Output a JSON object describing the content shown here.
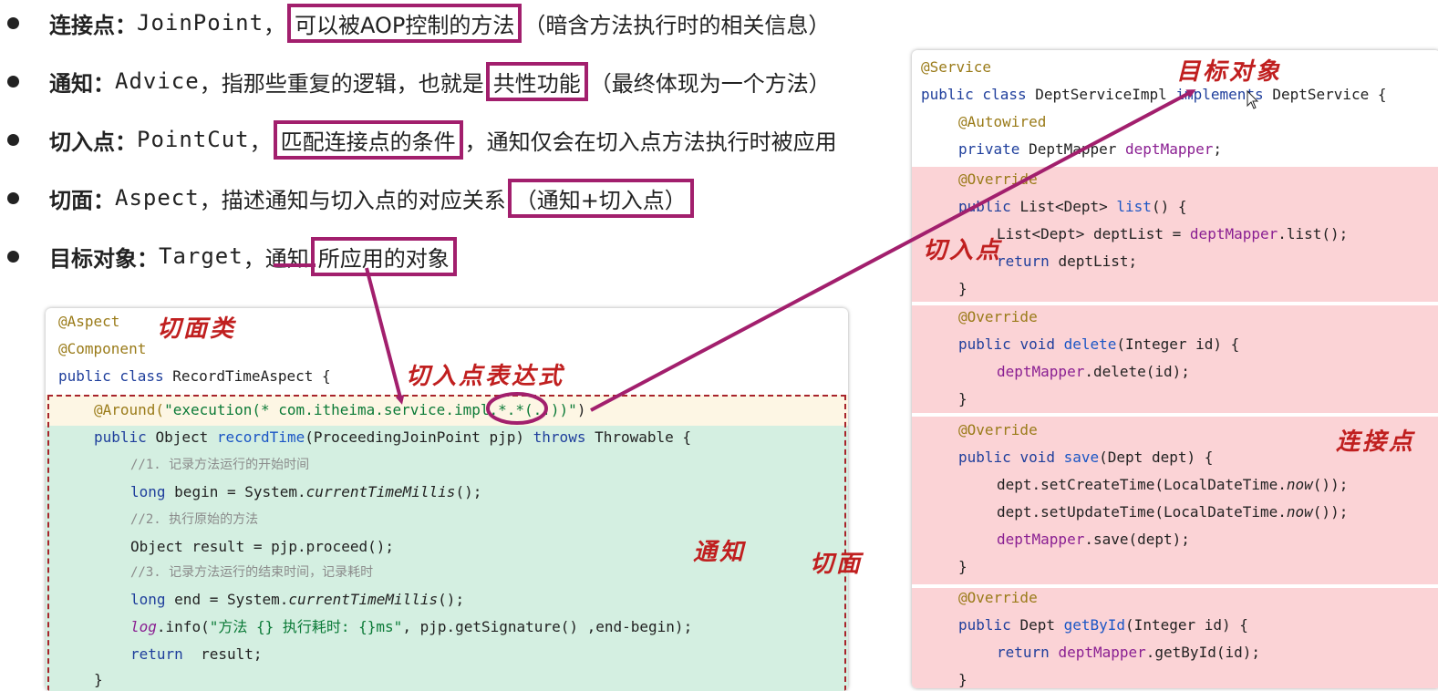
{
  "bullets": [
    {
      "term": "连接点：",
      "code": "JoinPoint",
      "sep": "，",
      "highlight": "可以被AOP控制的方法",
      "rest": "（暗含方法执行时的相关信息）"
    },
    {
      "term": "通知：",
      "code": "Advice",
      "pre": "，指那些重复的逻辑，也就是",
      "highlight": "共性功能",
      "rest": "（最终体现为一个方法）"
    },
    {
      "term": "切入点：",
      "code": "PointCut",
      "sep": "，",
      "highlight": "匹配连接点的条件",
      "rest": "，通知仅会在切入点方法执行时被应用"
    },
    {
      "term": "切面：",
      "code": "Aspect",
      "pre": "，描述通知与切入点的对应关系",
      "highlight": "（通知+切入点）",
      "rest": ""
    },
    {
      "term": "目标对象：",
      "code": "Target",
      "pre": "，通知",
      "highlight": "所应用的对象",
      "rest": ""
    }
  ],
  "left_code": {
    "l1": "@Aspect",
    "l2": "@Component",
    "l3a": "public class ",
    "l3b": "RecordTimeAspect {",
    "l4a": "@Around(",
    "l4b": "\"execution(* com.itheima.service.impl.*.*(..))\"",
    "l4c": ")",
    "l5a": "public ",
    "l5b": "Object ",
    "l5c": "recordTime",
    "l5d": "(ProceedingJoinPoint pjp) ",
    "l5e": "throws ",
    "l5f": "Throwable {",
    "l6": "//1. 记录方法运行的开始时间",
    "l7a": "long ",
    "l7b": "begin = System.",
    "l7c": "currentTimeMillis",
    "l7d": "();",
    "l8": "//2. 执行原始的方法",
    "l9": "Object result = pjp.proceed();",
    "l10": "//3. 记录方法运行的结束时间，记录耗时",
    "l11a": "long ",
    "l11b": "end = System.",
    "l11c": "currentTimeMillis",
    "l11d": "();",
    "l12a": "log",
    ".l12b": "",
    "l12b": ".info(",
    "l12c": "\"方法 {} 执行耗时: {}ms\"",
    "l12d": ", pjp.getSignature() ,end-begin);",
    "l13a": "return ",
    "l13b": " result;",
    "l14": "}"
  },
  "right_code": {
    "r1": "@Service",
    "r2a": "public class ",
    "r2b": "DeptServiceImpl ",
    "r2c": "implements ",
    "r2d": "DeptService {",
    "r3": "@Autowired",
    "r4a": "private ",
    "r4b": "DeptMapper ",
    "r4c": "deptMapper",
    ";": ";",
    "r4d": ";",
    "r5": "@Override",
    "r6a": "public ",
    "r6b": "List<Dept> ",
    "r6c": "list",
    "r6d": "() {",
    "r7a": "List<Dept> deptList = ",
    "r7b": "deptMapper",
    ".r7c": "",
    "r7c": ".list();",
    "r8a": "return ",
    "r8b": "deptList;",
    "r9": "}",
    "r10": "@Override",
    "r11a": "public ",
    "r11b": "void ",
    "r11c": "delete",
    "r11d": "(Integer id) {",
    "r12a": "deptMapper",
    "r12b": ".delete(id);",
    "r13": "}",
    "r14": "@Override",
    "r15a": "public ",
    "r15b": "void ",
    "r15c": "save",
    "r15d": "(Dept dept) {",
    "r16a": "dept.setCreateTime(LocalDateTime.",
    "r16b": "now",
    "r16c": "());",
    "r17a": "dept.setUpdateTime(LocalDateTime.",
    "r17b": "now",
    "r17c": "());",
    "r18a": "deptMapper",
    "r18b": ".save(dept);",
    "r19": "}",
    "r20": "@Override",
    "r21a": "public ",
    "r21b": "Dept ",
    "r21c": "getById",
    "r21d": "(Integer id) {",
    "r22a": "return ",
    "r22b": "deptMapper",
    "r22c": ".getById(id);",
    "r23": "}"
  },
  "handwritten": {
    "aspect_class": "切面类",
    "pointcut_expr": "切入点表达式",
    "advice": "通知",
    "aspect": "切面",
    "target": "目标对象",
    "pointcut": "切入点",
    "joinpoint": "连接点"
  },
  "colors": {
    "highlight_border": "#a21f6d",
    "advice_bg": "#d4efe1",
    "pointcut_bg": "#fdf6e4",
    "joinpoint_bg": "#fbd3d6",
    "hand": "#c01f1f"
  }
}
